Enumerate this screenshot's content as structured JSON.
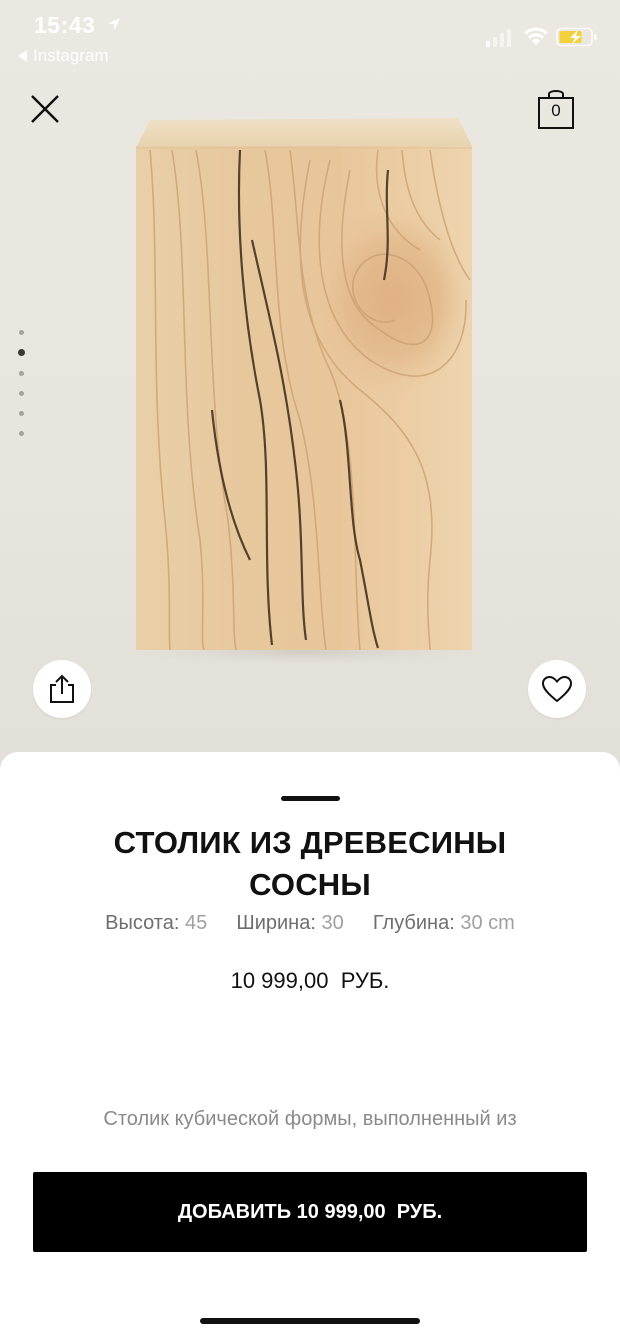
{
  "status_bar": {
    "time": "15:43",
    "back_app": "Instagram"
  },
  "header": {
    "cart_count": "0"
  },
  "gallery": {
    "image_count": 6,
    "active_index": 1
  },
  "product": {
    "title_line1": "СТОЛИК ИЗ ДРЕВЕСИНЫ",
    "title_line2": "СОСНЫ",
    "dimensions": {
      "height_label": "Высота:",
      "height_value": "45",
      "width_label": "Ширина:",
      "width_value": "30",
      "depth_label": "Глубина:",
      "depth_value": "30 cm"
    },
    "price": "10 999,00  РУБ.",
    "description": "Столик кубической формы, выполненный из"
  },
  "actions": {
    "add_to_cart_label": "ДОБАВИТЬ 10 999,00  РУБ."
  },
  "colors": {
    "button_bg": "#000000",
    "sheet_bg": "#ffffff",
    "photo_bg": "#ebe8e3",
    "wood": "#e6c9a0",
    "battery": "#f2d23c"
  },
  "icons": [
    "location-arrow-icon",
    "signal-icon",
    "wifi-icon",
    "battery-charging-icon",
    "close-icon",
    "shopping-bag-icon",
    "share-icon",
    "heart-icon"
  ]
}
